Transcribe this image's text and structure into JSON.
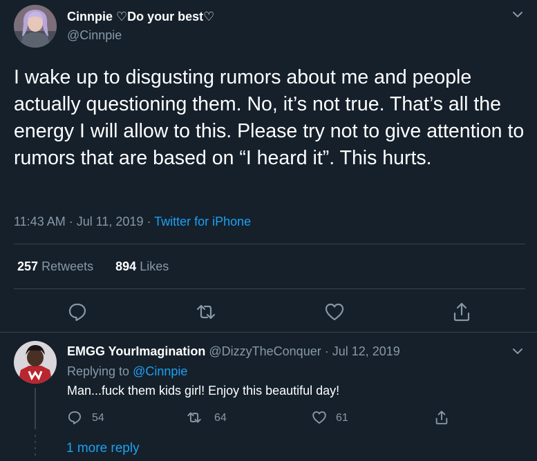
{
  "tweet": {
    "author_name": "Cinnpie ♡Do your best♡",
    "author_handle": "@Cinnpie",
    "text": "I wake up to disgusting rumors about me and people actually questioning them. No, it’s not true. That’s all the energy I will allow to this. Please try not to give attention to rumors that are based on “I heard it”. This hurts.",
    "time": "11:43 AM · Jul 11, 2019 · ",
    "source": "Twitter for iPhone",
    "retweets_count": "257",
    "retweets_label": "Retweets",
    "likes_count": "894",
    "likes_label": "Likes"
  },
  "reply": {
    "author_name": "EMGG YourImagination",
    "author_handle": "@DizzyTheConquer · Jul 12, 2019",
    "replying_to_label": "Replying to ",
    "replying_to_handle": "@Cinnpie",
    "text": "Man...fuck them kids girl! Enjoy this beautiful day!",
    "reply_count": "54",
    "retweet_count": "64",
    "like_count": "61"
  },
  "more_replies": "1 more reply",
  "icons": {
    "reply": "reply-icon",
    "retweet": "retweet-icon",
    "like": "heart-icon",
    "share": "share-icon",
    "menu": "chevron-down-icon"
  },
  "colors": {
    "background": "#15202b",
    "accent": "#1da1f2",
    "secondary_text": "#8899a6",
    "divider": "#38444d"
  }
}
